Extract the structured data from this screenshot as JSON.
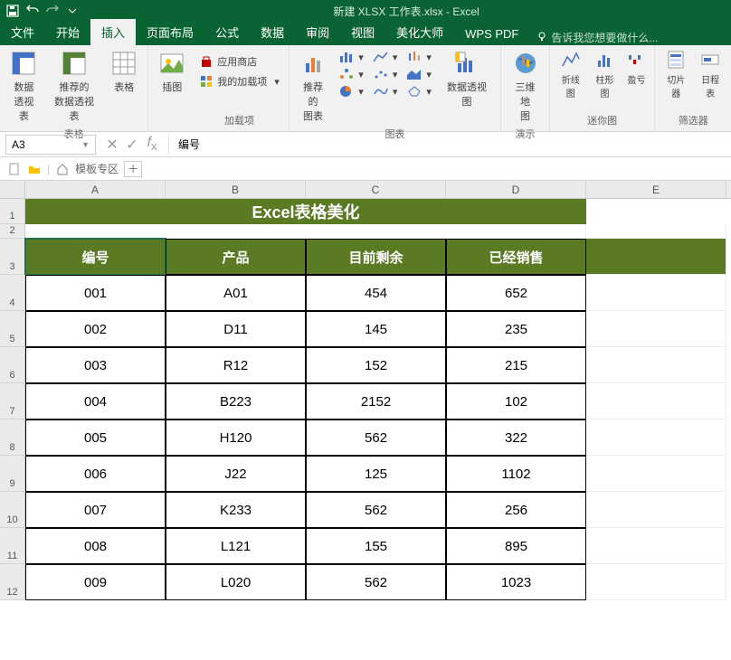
{
  "titlebar": {
    "title": "新建 XLSX 工作表.xlsx - Excel"
  },
  "menu": {
    "file": "文件",
    "home": "开始",
    "insert": "插入",
    "pagelayout": "页面布局",
    "formulas": "公式",
    "data": "数据",
    "review": "审阅",
    "view": "视图",
    "beautify": "美化大师",
    "wpspdf": "WPS PDF",
    "tell": "告诉我您想要做什么..."
  },
  "ribbon": {
    "groups": {
      "tables": {
        "label": "表格",
        "pivot": "数据\n透视表",
        "recpivot": "推荐的\n数据透视表",
        "table": "表格"
      },
      "illus": {
        "label": "插图",
        "btn": "插图"
      },
      "addins": {
        "label": "加载项",
        "store": "应用商店",
        "myaddins": "我的加载项"
      },
      "charts": {
        "label": "图表",
        "reccharts": "推荐的\n图表",
        "pivotchart": "数据透视图"
      },
      "tours": {
        "label": "演示",
        "map3d": "三维地\n图"
      },
      "spark": {
        "label": "迷你图",
        "line": "折线图",
        "column": "柱形图",
        "winloss": "盈亏"
      },
      "filter": {
        "label": "筛选器",
        "slicer": "切片器",
        "timeline": "日程表"
      }
    }
  },
  "formula": {
    "cellref": "A3",
    "value": "编号"
  },
  "sheettab": {
    "template": "模板专区"
  },
  "columns": [
    "A",
    "B",
    "C",
    "D",
    "E"
  ],
  "sheet": {
    "merged_title": "Excel表格美化",
    "headers": {
      "id": "编号",
      "product": "产品",
      "remaining": "目前剩余",
      "sold": "已经销售"
    },
    "rows": [
      {
        "id": "001",
        "product": "A01",
        "remaining": "454",
        "sold": "652"
      },
      {
        "id": "002",
        "product": "D11",
        "remaining": "145",
        "sold": "235"
      },
      {
        "id": "003",
        "product": "R12",
        "remaining": "152",
        "sold": "215"
      },
      {
        "id": "004",
        "product": "B223",
        "remaining": "2152",
        "sold": "102"
      },
      {
        "id": "005",
        "product": "H120",
        "remaining": "562",
        "sold": "322"
      },
      {
        "id": "006",
        "product": "J22",
        "remaining": "125",
        "sold": "1102"
      },
      {
        "id": "007",
        "product": "K233",
        "remaining": "562",
        "sold": "256"
      },
      {
        "id": "008",
        "product": "L121",
        "remaining": "155",
        "sold": "895"
      },
      {
        "id": "009",
        "product": "L020",
        "remaining": "562",
        "sold": "1023"
      }
    ]
  }
}
